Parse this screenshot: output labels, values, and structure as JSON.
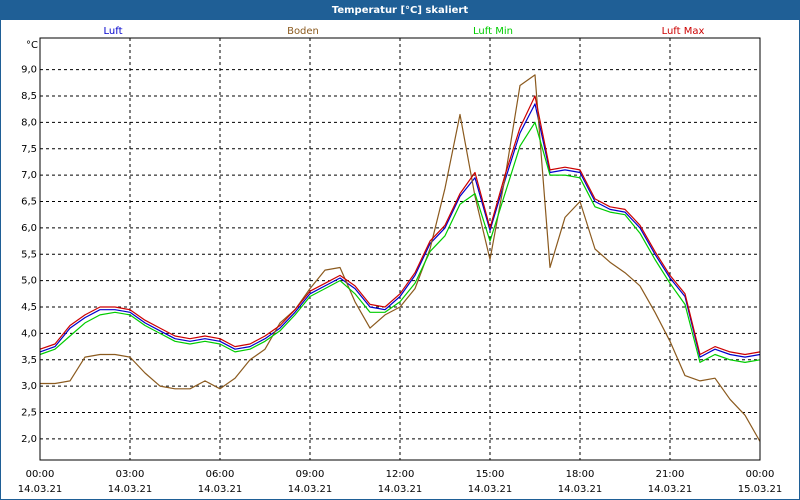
{
  "window": {
    "title": "Temperatur [°C] skaliert"
  },
  "chart_data": {
    "type": "line",
    "unit_label": "°C",
    "ylim": [
      1.6,
      9.6
    ],
    "yticks": [
      2.0,
      2.5,
      3.0,
      3.5,
      4.0,
      4.5,
      5.0,
      5.5,
      6.0,
      6.5,
      7.0,
      7.5,
      8.0,
      8.5,
      9.0
    ],
    "ytick_labels": [
      "2,0",
      "2,5",
      "3,0",
      "3,5",
      "4,0",
      "4,5",
      "5,0",
      "5,5",
      "6,0",
      "6,5",
      "7,0",
      "7,5",
      "8,0",
      "8,5",
      "9,0"
    ],
    "xlim": [
      0,
      24
    ],
    "xticks": [
      {
        "h": 0,
        "time": "00:00",
        "date": "14.03.21"
      },
      {
        "h": 3,
        "time": "03:00",
        "date": "14.03.21"
      },
      {
        "h": 6,
        "time": "06:00",
        "date": "14.03.21"
      },
      {
        "h": 9,
        "time": "09:00",
        "date": "14.03.21"
      },
      {
        "h": 12,
        "time": "12:00",
        "date": "14.03.21"
      },
      {
        "h": 15,
        "time": "15:00",
        "date": "14.03.21"
      },
      {
        "h": 18,
        "time": "18:00",
        "date": "14.03.21"
      },
      {
        "h": 21,
        "time": "21:00",
        "date": "14.03.21"
      },
      {
        "h": 24,
        "time": "00:00",
        "date": "15.03.21"
      }
    ],
    "grid": true,
    "x": [
      0,
      0.5,
      1,
      1.5,
      2,
      2.5,
      3,
      3.5,
      4,
      4.5,
      5,
      5.5,
      6,
      6.5,
      7,
      7.5,
      8,
      8.5,
      9,
      9.5,
      10,
      10.5,
      11,
      11.5,
      12,
      12.5,
      13,
      13.5,
      14,
      14.5,
      15,
      15.5,
      16,
      16.5,
      17,
      17.5,
      18,
      18.5,
      19,
      19.5,
      20,
      20.5,
      21,
      21.5,
      22,
      22.5,
      23,
      23.5,
      24
    ],
    "series": [
      {
        "name": "Luft",
        "color": "#0000cc",
        "values": [
          3.65,
          3.75,
          4.1,
          4.3,
          4.45,
          4.45,
          4.4,
          4.2,
          4.05,
          3.9,
          3.85,
          3.9,
          3.85,
          3.7,
          3.75,
          3.9,
          4.1,
          4.4,
          4.75,
          4.9,
          5.05,
          4.85,
          4.5,
          4.45,
          4.7,
          5.1,
          5.7,
          6.0,
          6.6,
          6.95,
          5.95,
          6.9,
          7.8,
          8.35,
          7.05,
          7.1,
          7.05,
          6.5,
          6.35,
          6.3,
          6.0,
          5.5,
          5.05,
          4.7,
          3.55,
          3.7,
          3.6,
          3.55,
          3.6
        ]
      },
      {
        "name": "Boden",
        "color": "#8b5a1e",
        "values": [
          3.05,
          3.05,
          3.1,
          3.55,
          3.6,
          3.6,
          3.55,
          3.25,
          3.0,
          2.95,
          2.95,
          3.1,
          2.95,
          3.15,
          3.5,
          3.7,
          4.2,
          4.45,
          4.85,
          5.2,
          5.25,
          4.6,
          4.1,
          4.35,
          4.5,
          4.85,
          5.6,
          6.75,
          8.15,
          6.6,
          5.4,
          6.95,
          8.7,
          8.9,
          5.25,
          6.2,
          6.5,
          5.6,
          5.35,
          5.15,
          4.9,
          4.4,
          3.85,
          3.2,
          3.1,
          3.15,
          2.75,
          2.45,
          1.95
        ]
      },
      {
        "name": "Luft Min",
        "color": "#00cc00",
        "values": [
          3.6,
          3.7,
          3.95,
          4.2,
          4.35,
          4.4,
          4.35,
          4.15,
          4.0,
          3.85,
          3.8,
          3.85,
          3.8,
          3.65,
          3.7,
          3.85,
          4.05,
          4.35,
          4.7,
          4.85,
          5.0,
          4.75,
          4.4,
          4.4,
          4.6,
          4.95,
          5.55,
          5.85,
          6.45,
          6.65,
          5.75,
          6.65,
          7.55,
          8.0,
          7.0,
          7.0,
          6.95,
          6.4,
          6.3,
          6.25,
          5.9,
          5.4,
          4.95,
          4.55,
          3.45,
          3.6,
          3.5,
          3.45,
          3.5
        ]
      },
      {
        "name": "Luft Max",
        "color": "#cc0000",
        "values": [
          3.7,
          3.8,
          4.15,
          4.35,
          4.5,
          4.5,
          4.45,
          4.25,
          4.1,
          3.95,
          3.9,
          3.95,
          3.9,
          3.75,
          3.8,
          3.95,
          4.15,
          4.45,
          4.8,
          4.95,
          5.1,
          4.9,
          4.55,
          4.5,
          4.75,
          5.15,
          5.75,
          6.05,
          6.65,
          7.05,
          6.0,
          7.0,
          7.9,
          8.5,
          7.1,
          7.15,
          7.1,
          6.55,
          6.4,
          6.35,
          6.05,
          5.55,
          5.1,
          4.75,
          3.6,
          3.75,
          3.65,
          3.6,
          3.65
        ]
      }
    ]
  }
}
